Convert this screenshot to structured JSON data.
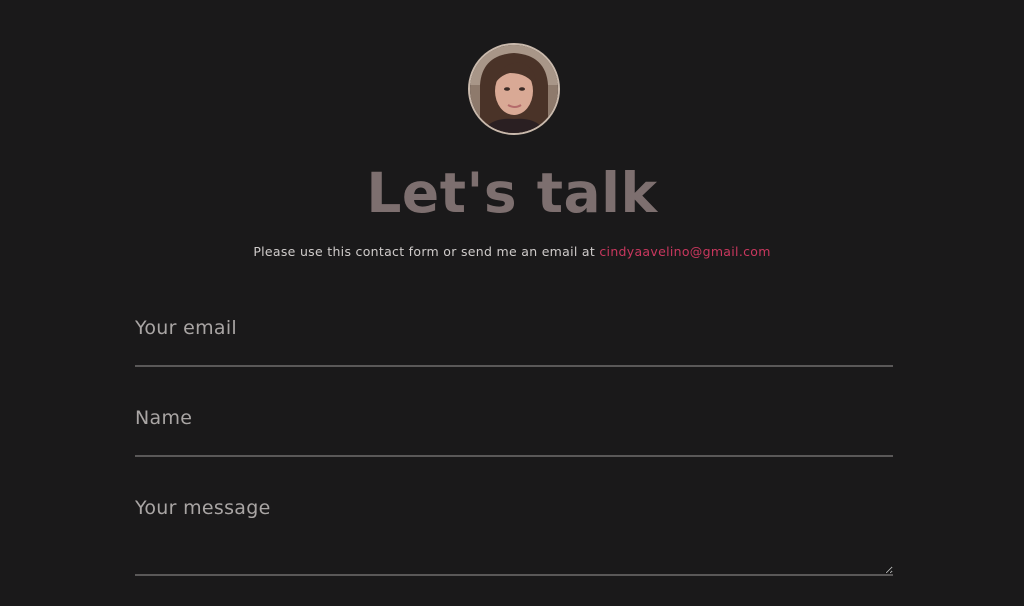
{
  "avatar": {
    "alt": "Profile photo"
  },
  "heading": "Let's talk",
  "subtitle": {
    "text": "Please use this contact form or send me an email at ",
    "email_link": "cindyaavelino@gmail.com"
  },
  "form": {
    "email_placeholder": "Your email",
    "name_placeholder": "Name",
    "message_placeholder": "Your message"
  },
  "colors": {
    "background": "#1a191a",
    "heading": "#7d6f6f",
    "link_accent": "#c9375e",
    "field_underline": "#5a5858"
  }
}
